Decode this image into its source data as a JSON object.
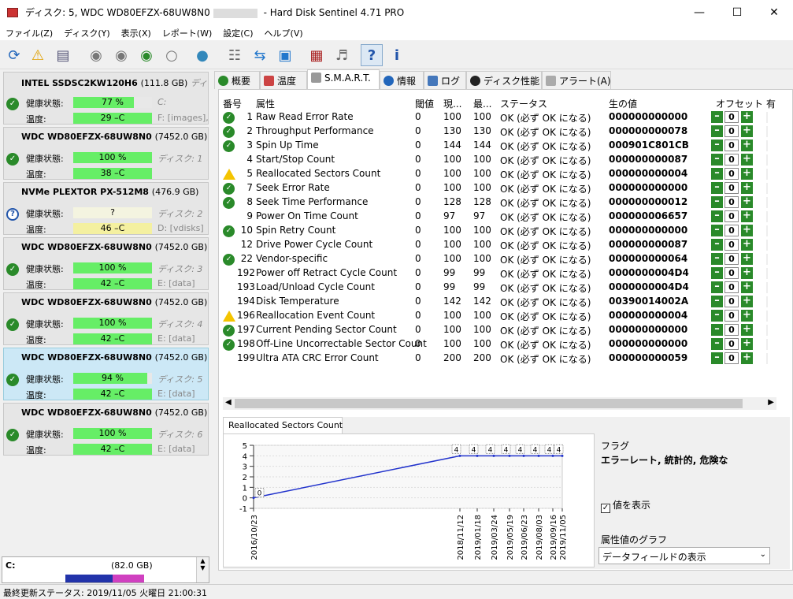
{
  "window": {
    "title": "ディスク: 5, WDC WD80EFZX-68UW8N0",
    "title_suffix": "- Hard Disk Sentinel 4.71 PRO"
  },
  "menu": [
    "ファイル(Z)",
    "ディスク(Y)",
    "表示(X)",
    "レポート(W)",
    "設定(C)",
    "ヘルプ(V)"
  ],
  "disks": [
    {
      "name": "INTEL SSDSC2KW120H6",
      "cap": "(111.8 GB)",
      "label": "ディスク:",
      "health_label": "健康状態:",
      "health": "77 %",
      "health_pct": 77,
      "temp_label": "温度:",
      "temp": "29 –C",
      "state": "ok",
      "drive": "C:",
      "drive2": "F: [images],"
    },
    {
      "name": "WDC WD80EFZX-68UW8N0",
      "cap": "(7452.0 GB)",
      "label": "",
      "health_label": "健康状態:",
      "health": "100 %",
      "health_pct": 100,
      "temp_label": "温度:",
      "temp": "38 –C",
      "state": "ok",
      "drive": "ディスク: 1",
      "drive2": ""
    },
    {
      "name": "NVMe   PLEXTOR PX-512M8",
      "cap": "(476.9 GB)",
      "label": "",
      "health_label": "健康状態:",
      "health": "?",
      "health_pct": 100,
      "temp_label": "温度:",
      "temp": "46 –C",
      "state": "unknown",
      "drive": "ディスク: 2",
      "drive2": "D: [vdisks]"
    },
    {
      "name": "WDC WD80EFZX-68UW8N0",
      "cap": "(7452.0 GB)",
      "label": "",
      "health_label": "健康状態:",
      "health": "100 %",
      "health_pct": 100,
      "temp_label": "温度:",
      "temp": "42 –C",
      "state": "ok",
      "drive": "ディスク: 3",
      "drive2": "E: [data]"
    },
    {
      "name": "WDC WD80EFZX-68UW8N0",
      "cap": "(7452.0 GB)",
      "label": "",
      "health_label": "健康状態:",
      "health": "100 %",
      "health_pct": 100,
      "temp_label": "温度:",
      "temp": "42 –C",
      "state": "ok",
      "drive": "ディスク: 4",
      "drive2": "E: [data]"
    },
    {
      "name": "WDC WD80EFZX-68UW8N0",
      "cap": "(7452.0 GB)",
      "label": "",
      "health_label": "健康状態:",
      "health": "94 %",
      "health_pct": 94,
      "temp_label": "温度:",
      "temp": "42 –C",
      "state": "ok",
      "drive": "ディスク: 5",
      "drive2": "E: [data]"
    },
    {
      "name": "WDC WD80EFZX-68UW8N0",
      "cap": "(7452.0 GB)",
      "label": "",
      "health_label": "健康状態:",
      "health": "100 %",
      "health_pct": 100,
      "temp_label": "温度:",
      "temp": "42 –C",
      "state": "ok",
      "drive": "ディスク: 6",
      "drive2": "E: [data]"
    }
  ],
  "partition": {
    "label": "C:",
    "size": "(82.0 GB)"
  },
  "statusbar": "最終更新ステータス: 2019/11/05 火曜日 21:00:31",
  "tabs": [
    "概要",
    "温度",
    "S.M.A.R.T.",
    "情報",
    "ログ",
    "ディスク性能",
    "アラート(A)"
  ],
  "smart": {
    "headers": [
      "番号",
      "属性",
      "閾値",
      "現...",
      "最...",
      "ステータス",
      "生の値",
      "オフセット",
      "有"
    ],
    "rows": [
      {
        "st": "ok",
        "id": "1",
        "attr": "Raw Read Error Rate",
        "thr": "0",
        "cur": "100",
        "worst": "100",
        "status": "OK (必ず OK になる)",
        "raw": "000000000000",
        "off": "0"
      },
      {
        "st": "ok",
        "id": "2",
        "attr": "Throughput Performance",
        "thr": "0",
        "cur": "130",
        "worst": "130",
        "status": "OK (必ず OK になる)",
        "raw": "000000000078",
        "off": "0"
      },
      {
        "st": "ok",
        "id": "3",
        "attr": "Spin Up Time",
        "thr": "0",
        "cur": "144",
        "worst": "144",
        "status": "OK (必ず OK になる)",
        "raw": "000901C801CB",
        "off": "0"
      },
      {
        "st": "",
        "id": "4",
        "attr": "Start/Stop Count",
        "thr": "0",
        "cur": "100",
        "worst": "100",
        "status": "OK (必ず OK になる)",
        "raw": "000000000087",
        "off": "0"
      },
      {
        "st": "warn",
        "id": "5",
        "attr": "Reallocated Sectors Count",
        "thr": "0",
        "cur": "100",
        "worst": "100",
        "status": "OK (必ず OK になる)",
        "raw": "000000000004",
        "off": "0"
      },
      {
        "st": "ok",
        "id": "7",
        "attr": "Seek Error Rate",
        "thr": "0",
        "cur": "100",
        "worst": "100",
        "status": "OK (必ず OK になる)",
        "raw": "000000000000",
        "off": "0"
      },
      {
        "st": "ok",
        "id": "8",
        "attr": "Seek Time Performance",
        "thr": "0",
        "cur": "128",
        "worst": "128",
        "status": "OK (必ず OK になる)",
        "raw": "000000000012",
        "off": "0"
      },
      {
        "st": "",
        "id": "9",
        "attr": "Power On Time Count",
        "thr": "0",
        "cur": "97",
        "worst": "97",
        "status": "OK (必ず OK になる)",
        "raw": "000000006657",
        "off": "0"
      },
      {
        "st": "ok",
        "id": "10",
        "attr": "Spin Retry Count",
        "thr": "0",
        "cur": "100",
        "worst": "100",
        "status": "OK (必ず OK になる)",
        "raw": "000000000000",
        "off": "0"
      },
      {
        "st": "",
        "id": "12",
        "attr": "Drive Power Cycle Count",
        "thr": "0",
        "cur": "100",
        "worst": "100",
        "status": "OK (必ず OK になる)",
        "raw": "000000000087",
        "off": "0"
      },
      {
        "st": "ok",
        "id": "22",
        "attr": "Vendor-specific",
        "thr": "0",
        "cur": "100",
        "worst": "100",
        "status": "OK (必ず OK になる)",
        "raw": "000000000064",
        "off": "0"
      },
      {
        "st": "",
        "id": "192",
        "attr": "Power off Retract Cycle Count",
        "thr": "0",
        "cur": "99",
        "worst": "99",
        "status": "OK (必ず OK になる)",
        "raw": "0000000004D4",
        "off": "0"
      },
      {
        "st": "",
        "id": "193",
        "attr": "Load/Unload Cycle Count",
        "thr": "0",
        "cur": "99",
        "worst": "99",
        "status": "OK (必ず OK になる)",
        "raw": "0000000004D4",
        "off": "0"
      },
      {
        "st": "",
        "id": "194",
        "attr": "Disk Temperature",
        "thr": "0",
        "cur": "142",
        "worst": "142",
        "status": "OK (必ず OK になる)",
        "raw": "00390014002A",
        "off": "0"
      },
      {
        "st": "warn",
        "id": "196",
        "attr": "Reallocation Event Count",
        "thr": "0",
        "cur": "100",
        "worst": "100",
        "status": "OK (必ず OK になる)",
        "raw": "000000000004",
        "off": "0"
      },
      {
        "st": "ok",
        "id": "197",
        "attr": "Current Pending Sector Count",
        "thr": "0",
        "cur": "100",
        "worst": "100",
        "status": "OK (必ず OK になる)",
        "raw": "000000000000",
        "off": "0"
      },
      {
        "st": "ok",
        "id": "198",
        "attr": "Off-Line Uncorrectable Sector Count",
        "thr": "0",
        "cur": "100",
        "worst": "100",
        "status": "OK (必ず OK になる)",
        "raw": "000000000000",
        "off": "0"
      },
      {
        "st": "",
        "id": "199",
        "attr": "Ultra ATA CRC Error Count",
        "thr": "0",
        "cur": "200",
        "worst": "200",
        "status": "OK (必ず OK になる)",
        "raw": "000000000059",
        "off": "0"
      }
    ]
  },
  "chart_panel": {
    "tab": "Reallocated Sectors Count",
    "flag_label": "フラグ",
    "flag_value": "エラーレート, 統計的, 危険な",
    "show_values": "値を表示",
    "graph_label": "属性値のグラフ",
    "graph_select": "データフィールドの表示"
  },
  "chart_data": {
    "type": "line",
    "x": [
      "2016/10/23",
      "2018/11/12",
      "2019/01/18",
      "2019/03/24",
      "2019/05/19",
      "2019/06/23",
      "2019/08/03",
      "2019/09/16",
      "2019/11/05"
    ],
    "values": [
      0,
      4,
      4,
      4,
      4,
      4,
      4,
      4,
      4
    ],
    "y_ticks": [
      "5",
      "4",
      "3",
      "2",
      "1",
      "0",
      "-1"
    ],
    "ylim": [
      -1,
      5
    ],
    "line_color": "#2233cc"
  }
}
